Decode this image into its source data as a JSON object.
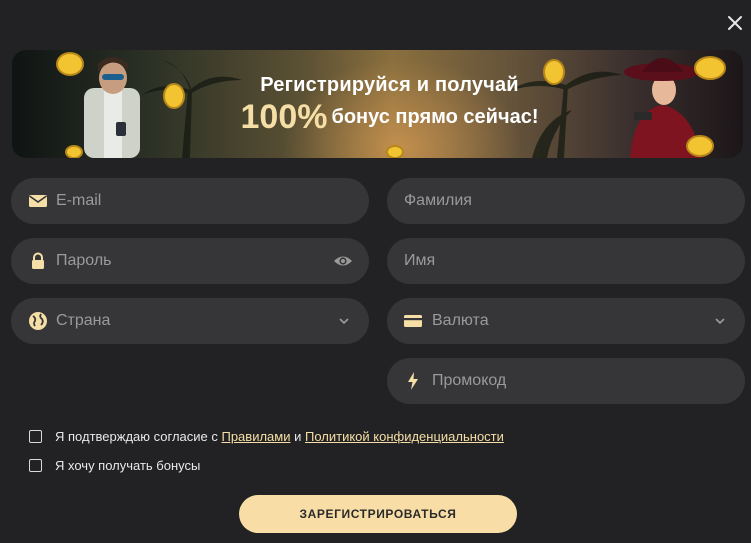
{
  "banner": {
    "line1": "Регистрируйся и получай",
    "percent": "100%",
    "line2_rest": "бонус прямо сейчас!"
  },
  "form": {
    "email": {
      "placeholder": "E-mail",
      "icon": "envelope-icon"
    },
    "last_name": {
      "placeholder": "Фамилия"
    },
    "password": {
      "placeholder": "Пароль",
      "icon": "lock-icon",
      "toggle_icon": "eye-icon"
    },
    "first_name": {
      "placeholder": "Имя"
    },
    "country": {
      "placeholder": "Страна",
      "icon": "globe-icon"
    },
    "currency": {
      "placeholder": "Валюта",
      "icon": "card-icon"
    },
    "promo": {
      "placeholder": "Промокод",
      "icon": "lightning-icon"
    }
  },
  "consent": {
    "prefix": "Я подтверждаю согласие с ",
    "rules_link": "Правилами",
    "conjunction": " и ",
    "privacy_link": "Политикой конфиденциальности"
  },
  "bonus_opt_in": {
    "label": "Я хочу получать бонусы"
  },
  "submit_label": "ЗАРЕГИСТРИРОВАТЬСЯ",
  "colors": {
    "background": "#222224",
    "field": "#363638",
    "accent": "#f8dea6",
    "icon": "#f6dfa6"
  }
}
